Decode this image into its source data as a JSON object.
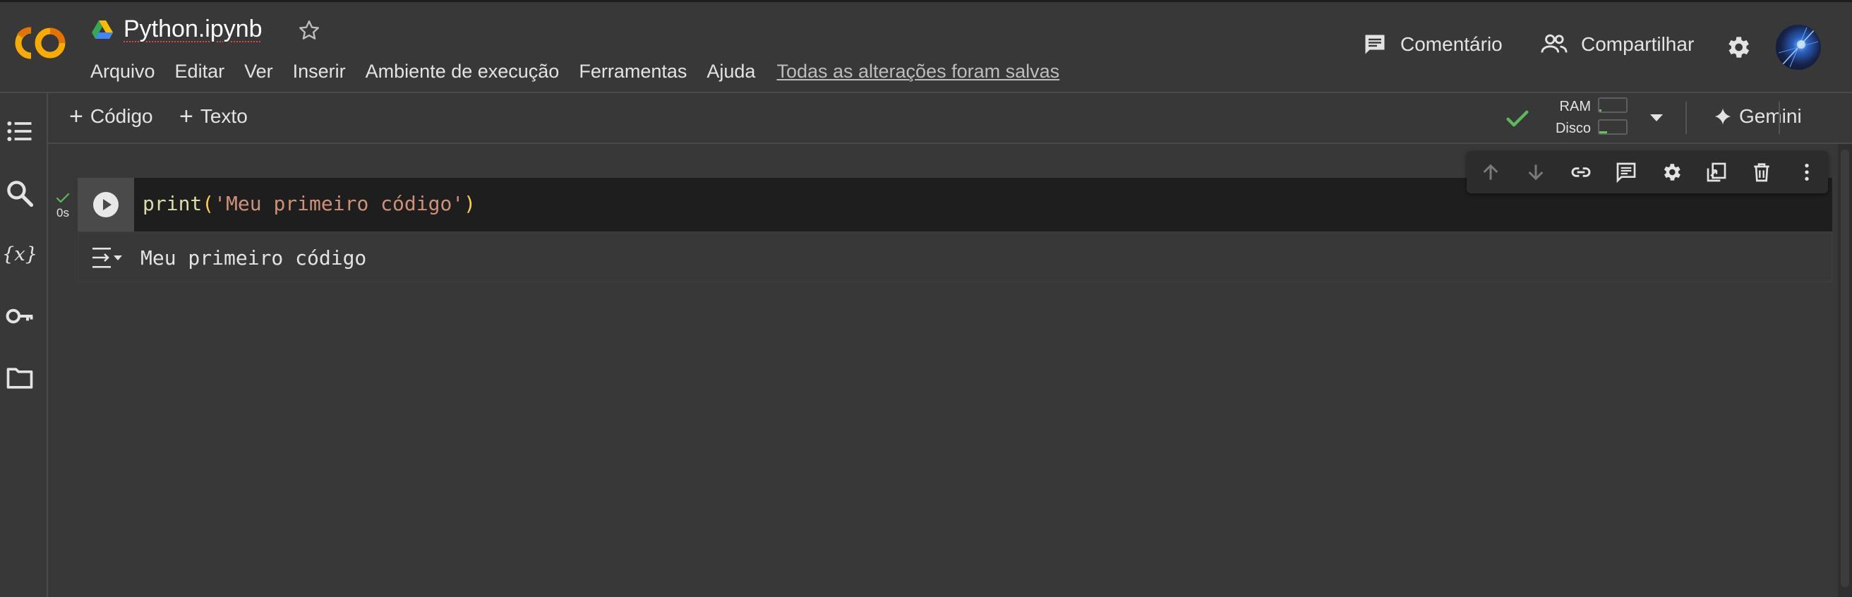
{
  "header": {
    "title": "Python.ipynb",
    "logo_text": "CO",
    "menu": [
      "Arquivo",
      "Editar",
      "Ver",
      "Inserir",
      "Ambiente de execução",
      "Ferramentas",
      "Ajuda"
    ],
    "save_status": "Todas as alterações foram salvas",
    "comment_label": "Comentário",
    "share_label": "Compartilhar"
  },
  "toolbar": {
    "add_code_label": "Código",
    "add_text_label": "Texto",
    "ram_label": "RAM",
    "disk_label": "Disco",
    "gemini_label": "Gemini"
  },
  "cell": {
    "exec_time": "0s",
    "code_fn": "print",
    "code_open": "(",
    "code_str": "'Meu primeiro código'",
    "code_close": ")",
    "output": "Meu primeiro código"
  },
  "colors": {
    "background": "#383838",
    "code_bg": "#1e1e1e",
    "accent_orange": "#f9ab00",
    "check_green": "#5cb85c"
  },
  "icons": {
    "left_rail": [
      "table-of-contents-icon",
      "search-icon",
      "variables-icon",
      "key-icon",
      "folder-icon"
    ],
    "cell_toolbar": [
      "arrow-up-icon",
      "arrow-down-icon",
      "link-icon",
      "comment-icon",
      "gear-icon",
      "mirror-cell-icon",
      "trash-icon",
      "more-vert-icon"
    ]
  }
}
